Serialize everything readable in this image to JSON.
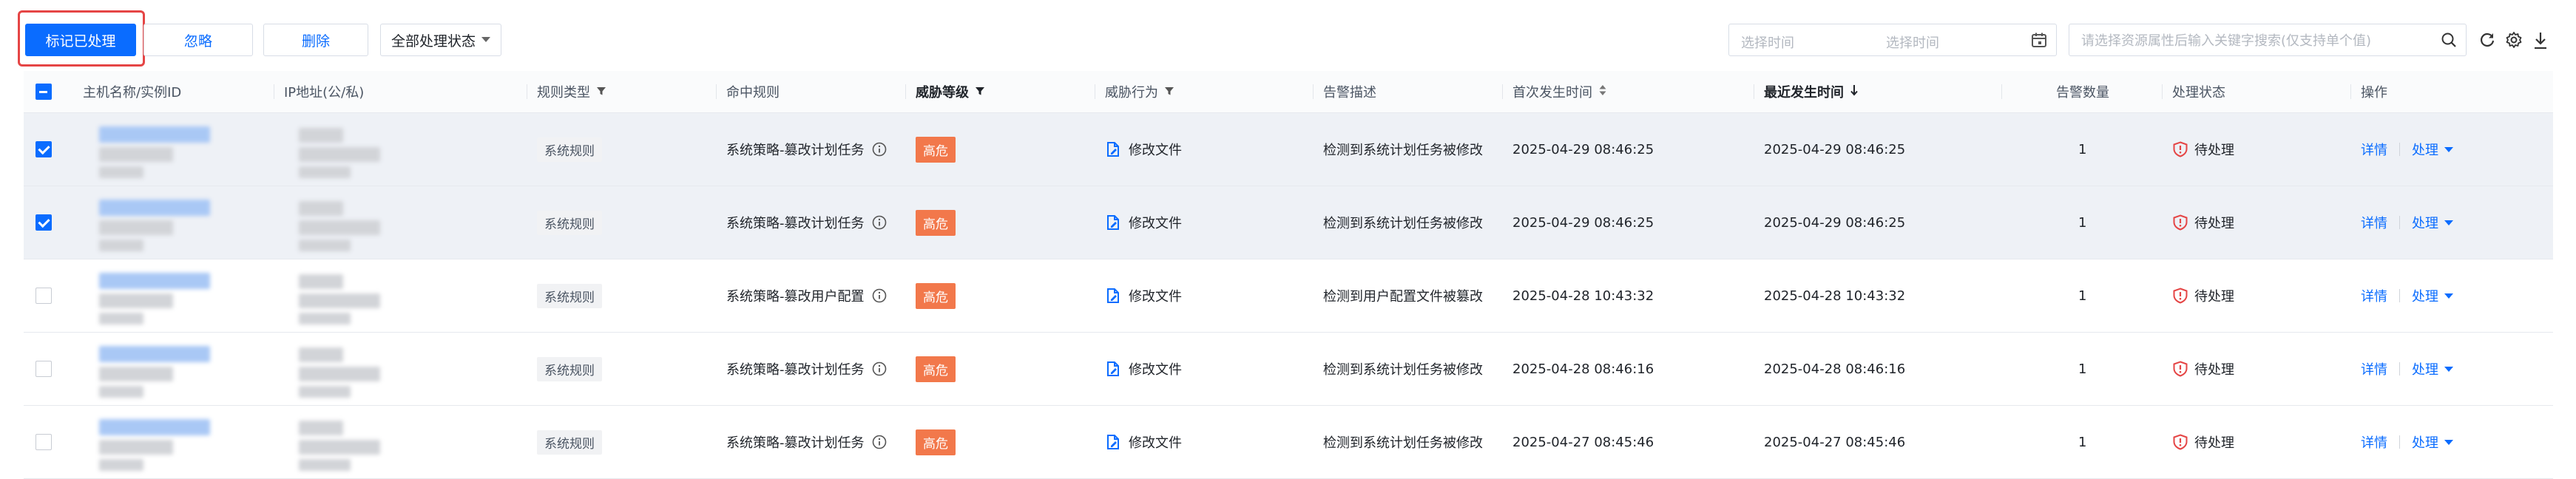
{
  "toolbar": {
    "mark_processed": "标记已处理",
    "ignore": "忽略",
    "delete": "删除",
    "status_filter": "全部处理状态",
    "date_start_placeholder": "选择时间",
    "date_end_placeholder": "选择时间",
    "search_placeholder": "请选择资源属性后输入关键字搜索(仅支持单个值)"
  },
  "columns": {
    "host": "主机名称/实例ID",
    "ip": "IP地址(公/私)",
    "rule_type": "规则类型",
    "hit_rule": "命中规则",
    "threat_level": "威胁等级",
    "threat_action": "威胁行为",
    "alert_desc": "告警描述",
    "first_time": "首次发生时间",
    "last_time": "最近发生时间",
    "alert_count": "告警数量",
    "status": "处理状态",
    "operation": "操作"
  },
  "rows": [
    {
      "selected": true,
      "rule_type": "系统规则",
      "hit_rule": "系统策略-篡改计划任务",
      "level": "高危",
      "action": "修改文件",
      "desc": "检测到系统计划任务被修改",
      "first": "2025-04-29 08:46:25",
      "last": "2025-04-29 08:46:25",
      "count": "1",
      "status": "待处理",
      "detail": "详情",
      "process": "处理"
    },
    {
      "selected": true,
      "rule_type": "系统规则",
      "hit_rule": "系统策略-篡改计划任务",
      "level": "高危",
      "action": "修改文件",
      "desc": "检测到系统计划任务被修改",
      "first": "2025-04-29 08:46:25",
      "last": "2025-04-29 08:46:25",
      "count": "1",
      "status": "待处理",
      "detail": "详情",
      "process": "处理"
    },
    {
      "selected": false,
      "rule_type": "系统规则",
      "hit_rule": "系统策略-篡改用户配置",
      "level": "高危",
      "action": "修改文件",
      "desc": "检测到用户配置文件被篡改",
      "first": "2025-04-28 10:43:32",
      "last": "2025-04-28 10:43:32",
      "count": "1",
      "status": "待处理",
      "detail": "详情",
      "process": "处理"
    },
    {
      "selected": false,
      "rule_type": "系统规则",
      "hit_rule": "系统策略-篡改计划任务",
      "level": "高危",
      "action": "修改文件",
      "desc": "检测到系统计划任务被修改",
      "first": "2025-04-28 08:46:16",
      "last": "2025-04-28 08:46:16",
      "count": "1",
      "status": "待处理",
      "detail": "详情",
      "process": "处理"
    },
    {
      "selected": false,
      "rule_type": "系统规则",
      "hit_rule": "系统策略-篡改计划任务",
      "level": "高危",
      "action": "修改文件",
      "desc": "检测到系统计划任务被修改",
      "first": "2025-04-27 08:45:46",
      "last": "2025-04-27 08:45:46",
      "count": "1",
      "status": "待处理",
      "detail": "详情",
      "process": "处理"
    }
  ],
  "colors": {
    "primary": "#0a6cff",
    "danger_tag": "#f2784b",
    "status_red": "#e54545",
    "selected_row": "#eef1f6"
  }
}
